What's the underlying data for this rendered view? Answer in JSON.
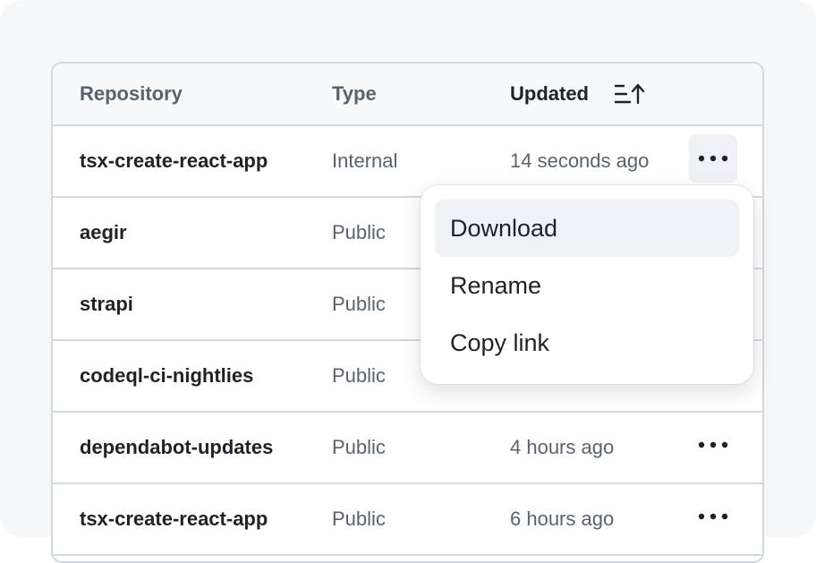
{
  "table": {
    "headers": {
      "repository": "Repository",
      "type": "Type",
      "updated": "Updated"
    },
    "sort_icon": "sort-ascending-icon",
    "rows": [
      {
        "name": "tsx-create-react-app",
        "type": "Internal",
        "updated": "14 seconds ago"
      },
      {
        "name": "aegir",
        "type": "Public",
        "updated": ""
      },
      {
        "name": "strapi",
        "type": "Public",
        "updated": ""
      },
      {
        "name": "codeql-ci-nightlies",
        "type": "Public",
        "updated": ""
      },
      {
        "name": "dependabot-updates",
        "type": "Public",
        "updated": "4 hours ago"
      },
      {
        "name": "tsx-create-react-app",
        "type": "Public",
        "updated": "6 hours ago"
      }
    ],
    "row_action_icon": "kebab-horizontal-icon"
  },
  "menu": {
    "items": [
      {
        "label": "Download"
      },
      {
        "label": "Rename"
      },
      {
        "label": "Copy link"
      }
    ]
  },
  "colors": {
    "border": "#d1d9e0",
    "header_bg": "#f6f8fa",
    "text_primary": "#1f2328",
    "text_secondary": "#59636e",
    "hover_bg": "#eff1f4"
  }
}
